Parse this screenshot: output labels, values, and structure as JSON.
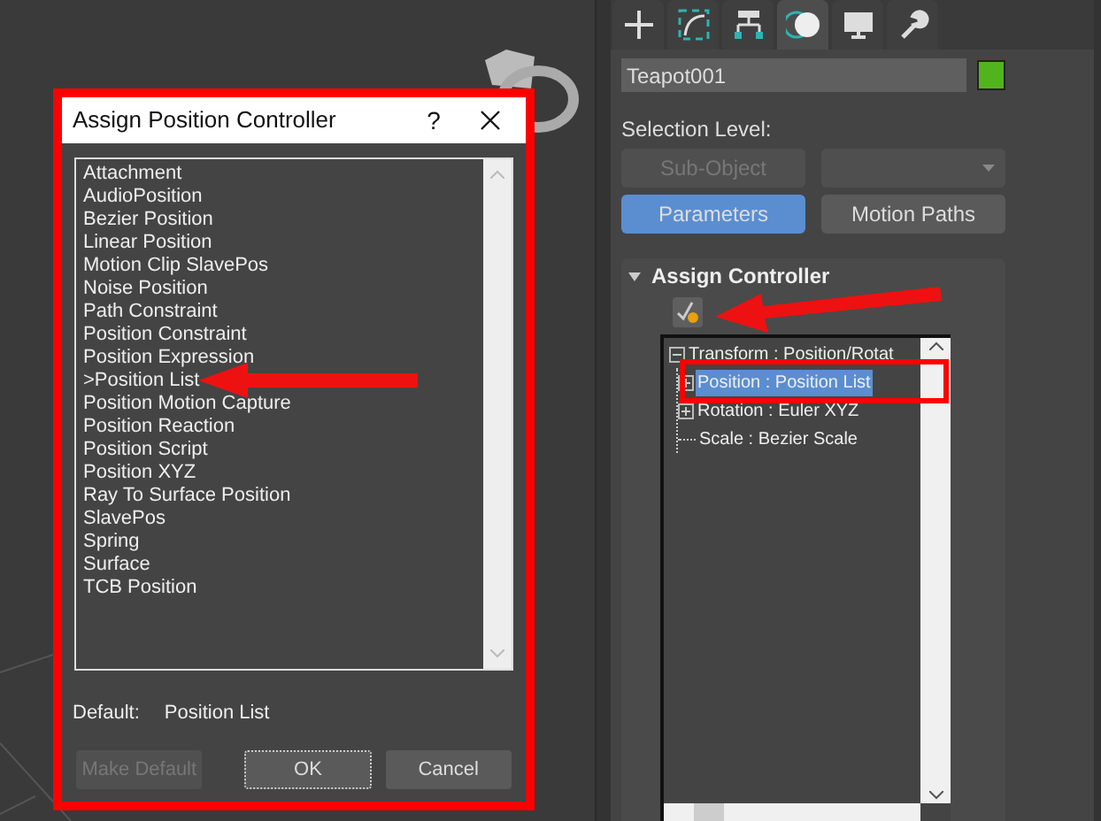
{
  "dialog": {
    "title": "Assign Position Controller",
    "help": "?",
    "items": [
      "Attachment",
      "AudioPosition",
      "Bezier Position",
      "Linear Position",
      "Motion Clip SlavePos",
      "Noise Position",
      "Path Constraint",
      "Position Constraint",
      "Position Expression",
      ">Position List",
      "Position Motion Capture",
      "Position Reaction",
      "Position Script",
      "Position XYZ",
      "Ray To Surface Position",
      "SlavePos",
      "Spring",
      "Surface",
      "TCB Position"
    ],
    "default_label": "Default:",
    "default_value": "Position List",
    "buttons": [
      {
        "label": "Make Default",
        "disabled": true
      },
      {
        "label": "OK",
        "disabled": false
      },
      {
        "label": "Cancel",
        "disabled": false
      }
    ]
  },
  "panel": {
    "tabs": [
      {
        "kind": "create",
        "selected": false
      },
      {
        "kind": "modify",
        "selected": false
      },
      {
        "kind": "hierarchy",
        "selected": false
      },
      {
        "kind": "motion",
        "selected": true
      },
      {
        "kind": "display",
        "selected": false
      },
      {
        "kind": "utilities",
        "selected": false
      }
    ],
    "object_name": "Teapot001",
    "selection_level": "Selection Level:",
    "sub_object": {
      "label": "Sub-Object",
      "disabled": true
    },
    "modes": [
      {
        "label": "Parameters",
        "selected": true
      },
      {
        "label": "Motion Paths",
        "selected": false
      }
    ],
    "rollout": {
      "title": "Assign Controller",
      "expanded": true
    },
    "tree": [
      {
        "label": "Transform : Position/Rotat",
        "expanded": true,
        "children": [
          {
            "label": "Position : Position List",
            "expanded": false,
            "selected": true
          },
          {
            "label": "Rotation : Euler XYZ",
            "expanded": false,
            "selected": false
          },
          {
            "label": "Scale : Bezier Scale",
            "selected": false
          }
        ]
      }
    ]
  }
}
